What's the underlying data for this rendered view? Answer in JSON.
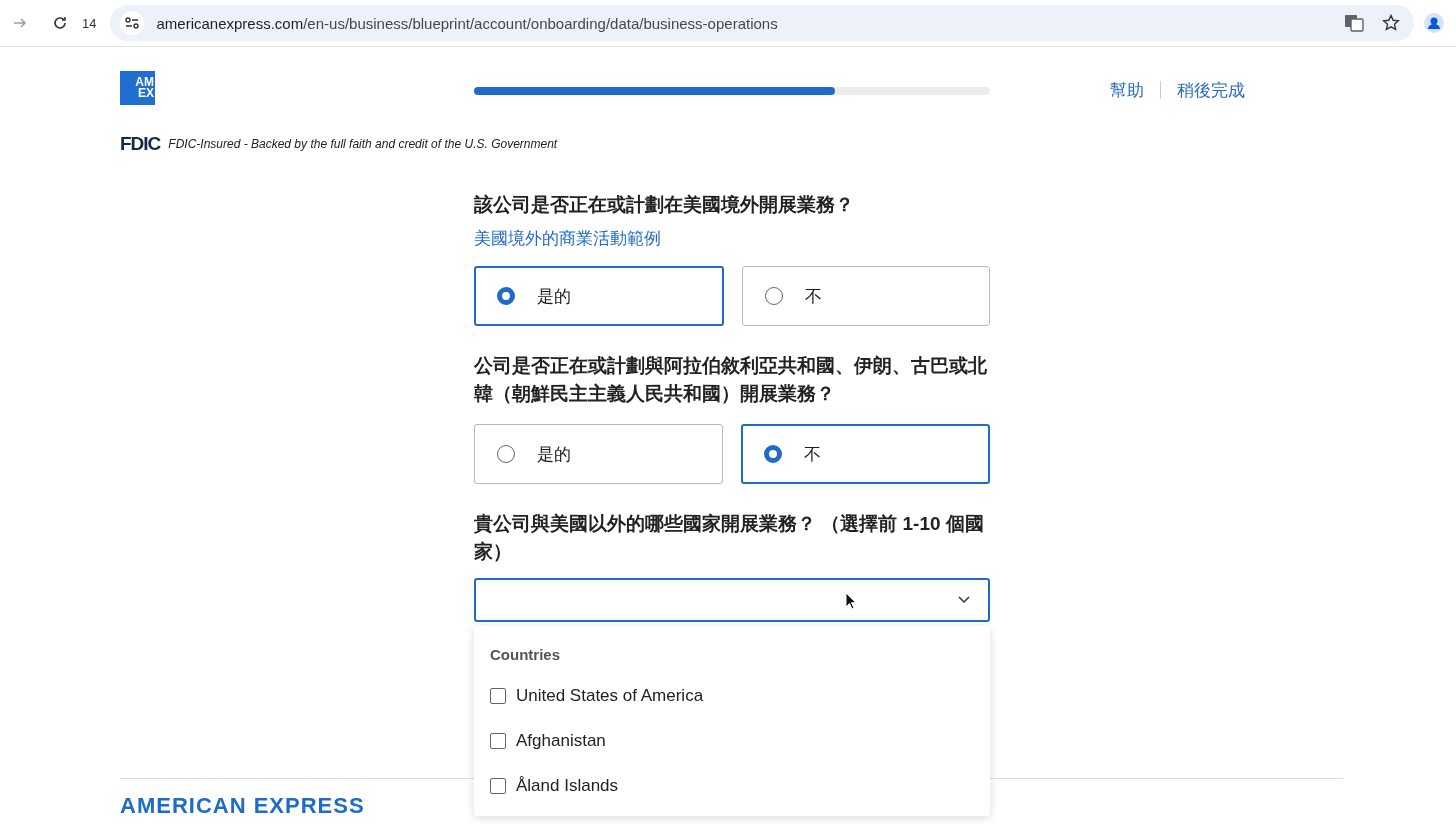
{
  "browser": {
    "tab_count": "14",
    "url_host": "americanexpress.com",
    "url_path": "/en-us/business/blueprint/account/onboarding/data/business-operations"
  },
  "header": {
    "logo": [
      "AM",
      "EX"
    ],
    "progress": {
      "level": 0.7
    },
    "links": [
      "幫助",
      "稍後完成"
    ],
    "fdic_mark": "FDIC",
    "fdic_text": "FDIC-Insured - Backed by the full faith and credit of the U.S. Government"
  },
  "questions": [
    {
      "kind": "radio",
      "text": "該公司是否正在或計劃在美國境外開展業務？",
      "link": "美國境外的商業活動範例",
      "options": [
        {
          "label": "是的",
          "selected": true
        },
        {
          "label": "不",
          "selected": false
        }
      ]
    },
    {
      "kind": "radio",
      "text": "公司是否正在或計劃與阿拉伯敘利亞共和國、伊朗、古巴或北韓（朝鮮民主主義人民共和國）開展業務？",
      "options": [
        {
          "label": "是的",
          "selected": false
        },
        {
          "label": "不",
          "selected": true
        }
      ]
    },
    {
      "kind": "select",
      "text": "貴公司與美國以外的哪些國家開展業務？ （選擇前 1-10 個國家）",
      "dropdown": {
        "group": "Countries",
        "options": [
          {
            "label": "United States of America",
            "checked": false
          },
          {
            "label": "Afghanistan",
            "checked": false
          },
          {
            "label": "Åland Islands",
            "checked": false
          }
        ]
      }
    }
  ],
  "footer": {
    "brand": "AMERICAN EXPRESS"
  }
}
